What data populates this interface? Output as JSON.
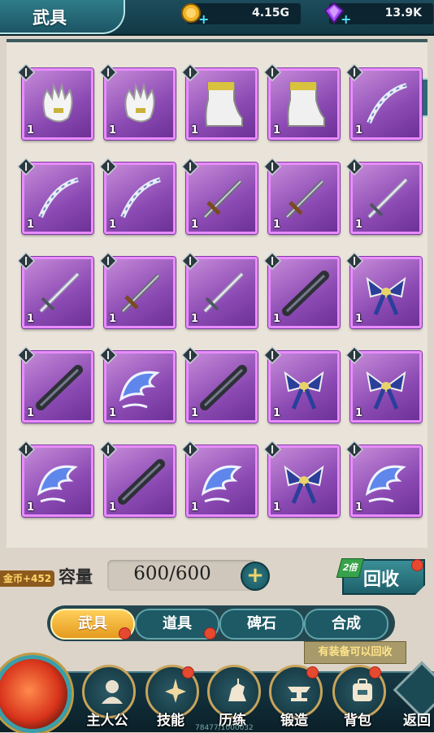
{
  "header": {
    "title": "武具",
    "gold": "4.15G",
    "gems": "13.9K"
  },
  "inventory": {
    "items": [
      {
        "type": "gloves",
        "qty": "1"
      },
      {
        "type": "gloves",
        "qty": "1"
      },
      {
        "type": "boots",
        "qty": "1"
      },
      {
        "type": "boots",
        "qty": "1"
      },
      {
        "type": "bow",
        "qty": "1"
      },
      {
        "type": "bow",
        "qty": "1"
      },
      {
        "type": "bow",
        "qty": "1"
      },
      {
        "type": "dagger",
        "qty": "1"
      },
      {
        "type": "dagger",
        "qty": "1"
      },
      {
        "type": "sword",
        "qty": "1"
      },
      {
        "type": "sword",
        "qty": "1"
      },
      {
        "type": "dagger",
        "qty": "1"
      },
      {
        "type": "sword",
        "qty": "1"
      },
      {
        "type": "staff",
        "qty": "1"
      },
      {
        "type": "ribbon",
        "qty": "1"
      },
      {
        "type": "staff",
        "qty": "1"
      },
      {
        "type": "wing",
        "qty": "1"
      },
      {
        "type": "staff",
        "qty": "1"
      },
      {
        "type": "ribbon",
        "qty": "1"
      },
      {
        "type": "ribbon",
        "qty": "1"
      },
      {
        "type": "wing",
        "qty": "1"
      },
      {
        "type": "staff",
        "qty": "1"
      },
      {
        "type": "wing",
        "qty": "1"
      },
      {
        "type": "ribbon",
        "qty": "1"
      },
      {
        "type": "wing",
        "qty": "1"
      }
    ]
  },
  "side_tag": "金币+452",
  "capacity": {
    "label": "容量",
    "value": "600/600"
  },
  "recycle": {
    "label": "回收",
    "badge": "2倍"
  },
  "tabs": [
    "武具",
    "道具",
    "碑石",
    "合成"
  ],
  "hint": "有装备可以回收",
  "nav": [
    "主人公",
    "技能",
    "历练",
    "锻造",
    "背包"
  ],
  "back_label": "返回",
  "bottom_counter": "78477/1000032",
  "colors": {
    "item_frame": "#e98cff",
    "accent_teal": "#1d5a66",
    "tab_active": "#ffcf5a"
  }
}
